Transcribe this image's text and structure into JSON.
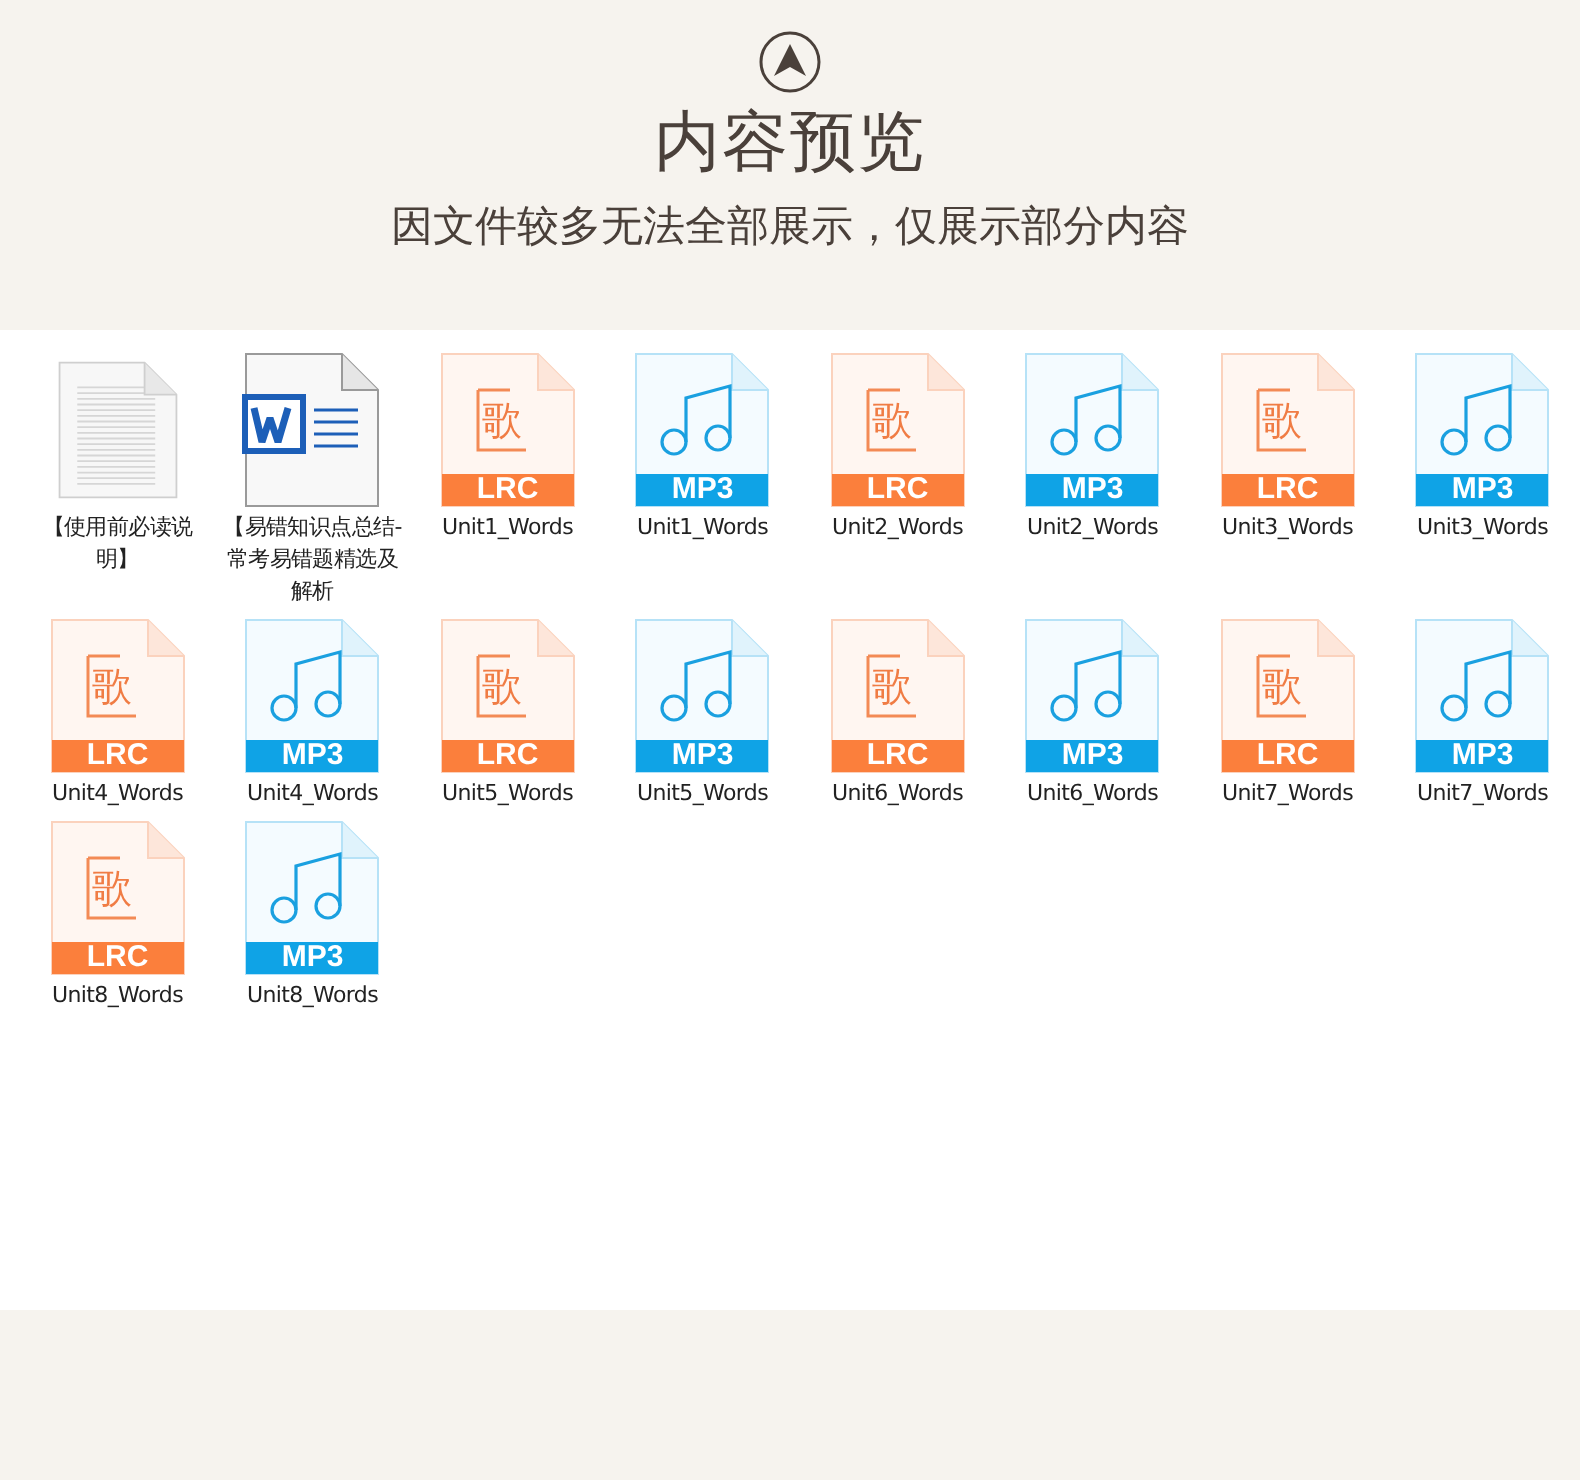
{
  "header": {
    "title": "内容预览",
    "subtitle": "因文件较多无法全部展示，仅展示部分内容"
  },
  "files": [
    {
      "kind": "text",
      "name": "【使用前必读说明】"
    },
    {
      "kind": "word",
      "name": "【易错知识点总结-常考易错题精选及解析"
    },
    {
      "kind": "lrc",
      "glyph": "歌",
      "badge": "LRC",
      "name": "Unit1_Words"
    },
    {
      "kind": "mp3",
      "badge": "MP3",
      "name": "Unit1_Words"
    },
    {
      "kind": "lrc",
      "glyph": "歌",
      "badge": "LRC",
      "name": "Unit2_Words"
    },
    {
      "kind": "mp3",
      "badge": "MP3",
      "name": "Unit2_Words"
    },
    {
      "kind": "lrc",
      "glyph": "歌",
      "badge": "LRC",
      "name": "Unit3_Words"
    },
    {
      "kind": "mp3",
      "badge": "MP3",
      "name": "Unit3_Words"
    },
    {
      "kind": "lrc",
      "glyph": "歌",
      "badge": "LRC",
      "name": "Unit4_Words"
    },
    {
      "kind": "mp3",
      "badge": "MP3",
      "name": "Unit4_Words"
    },
    {
      "kind": "lrc",
      "glyph": "歌",
      "badge": "LRC",
      "name": "Unit5_Words"
    },
    {
      "kind": "mp3",
      "badge": "MP3",
      "name": "Unit5_Words"
    },
    {
      "kind": "lrc",
      "glyph": "歌",
      "badge": "LRC",
      "name": "Unit6_Words"
    },
    {
      "kind": "mp3",
      "badge": "MP3",
      "name": "Unit6_Words"
    },
    {
      "kind": "lrc",
      "glyph": "歌",
      "badge": "LRC",
      "name": "Unit7_Words"
    },
    {
      "kind": "mp3",
      "badge": "MP3",
      "name": "Unit7_Words"
    },
    {
      "kind": "lrc",
      "glyph": "歌",
      "badge": "LRC",
      "name": "Unit8_Words"
    },
    {
      "kind": "mp3",
      "badge": "MP3",
      "name": "Unit8_Words"
    }
  ]
}
